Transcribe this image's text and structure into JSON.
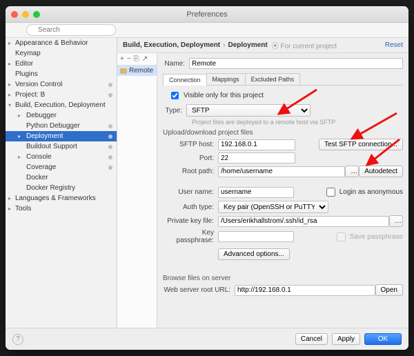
{
  "window": {
    "title": "Preferences"
  },
  "search": {
    "placeholder": "Search"
  },
  "sidebar": {
    "items": [
      {
        "label": "Appearance & Behavior",
        "expandable": true
      },
      {
        "label": "Keymap"
      },
      {
        "label": "Editor",
        "expandable": true
      },
      {
        "label": "Plugins"
      },
      {
        "label": "Version Control",
        "expandable": true,
        "dot": true
      },
      {
        "label": "Project: B",
        "expandable": true,
        "dot": true
      },
      {
        "label": "Build, Execution, Deployment",
        "expanded": true,
        "children": [
          {
            "label": "Debugger",
            "expandable": true
          },
          {
            "label": "Python Debugger",
            "dot": true
          },
          {
            "label": "Deployment",
            "dot": true,
            "selected": true,
            "expandable": true
          },
          {
            "label": "Buildout Support",
            "dot": true
          },
          {
            "label": "Console",
            "expandable": true,
            "dot": true
          },
          {
            "label": "Coverage",
            "dot": true
          },
          {
            "label": "Docker"
          },
          {
            "label": "Docker Registry"
          }
        ]
      },
      {
        "label": "Languages & Frameworks",
        "expandable": true
      },
      {
        "label": "Tools",
        "expandable": true
      }
    ]
  },
  "breadcrumb": {
    "path1": "Build, Execution, Deployment",
    "path2": "Deployment",
    "scope": "For current project",
    "reset": "Reset"
  },
  "servers": {
    "toolbar": {
      "add": "+",
      "remove": "−",
      "copy": "⎘",
      "arrow": "↗"
    },
    "items": [
      {
        "name": "Remote"
      }
    ]
  },
  "form": {
    "name_label": "Name:",
    "name_value": "Remote",
    "tabs": {
      "conn": "Connection",
      "map": "Mappings",
      "excl": "Excluded Paths"
    },
    "visible_label": "Visible only for this project",
    "type_label": "Type:",
    "type_value": "SFTP",
    "type_hint": "Project files are deployed to a remote host via SFTP",
    "section_upl": "Upload/download project files",
    "sftp_host_label": "SFTP host:",
    "sftp_host_value": "192.168.0.1",
    "test_btn": "Test SFTP connection...",
    "port_label": "Port:",
    "port_value": "22",
    "root_label": "Root path:",
    "root_value": "/home/username",
    "autodetect_btn": "Autodetect",
    "user_label": "User name:",
    "user_value": "username",
    "anon_label": "Login as anonymous",
    "auth_label": "Auth type:",
    "auth_value": "Key pair (OpenSSH or PuTTY)",
    "pkey_label": "Private key file:",
    "pkey_value": "/Users/erikhallstrom/.ssh/id_rsa",
    "pass_label": "Key passphrase:",
    "savepass_label": "Save passphrase",
    "advanced_btn": "Advanced options...",
    "section_browse": "Browse files on server",
    "web_label": "Web server root URL:",
    "web_value": "http://192.168.0.1",
    "open_btn": "Open"
  },
  "footer": {
    "cancel": "Cancel",
    "apply": "Apply",
    "ok": "OK"
  }
}
